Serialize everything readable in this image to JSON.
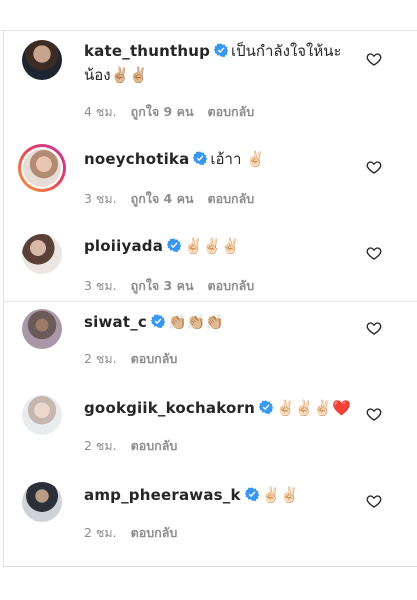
{
  "comments": [
    {
      "username": "kate_thunthup",
      "verified": true,
      "text_line1": "เป็นกำลังใจให้นะ",
      "text_line2": "น้อง✌🏼✌🏼",
      "time": "4 ชม.",
      "likes": "ถูกใจ 9 คน",
      "reply": "ตอบกลับ"
    },
    {
      "username": "noeychotika",
      "verified": true,
      "text_line1": "เอ้าา ✌🏻",
      "time": "3 ชม.",
      "likes": "ถูกใจ 4 คน",
      "reply": "ตอบกลับ"
    },
    {
      "username": "ploiiyada",
      "verified": true,
      "text_line1": "✌🏻✌🏻✌🏻",
      "time": "3 ชม.",
      "likes": "ถูกใจ 3 คน",
      "reply": "ตอบกลับ"
    },
    {
      "username": "siwat_c",
      "verified": true,
      "text_line1": "👏🏼👏🏼👏🏼",
      "time": "2 ชม.",
      "reply": "ตอบกลับ"
    },
    {
      "username": "gookgiik_kochakorn",
      "verified": true,
      "text_line1": "✌🏻✌🏻✌🏻❤️",
      "time": "2 ชม.",
      "reply": "ตอบกลับ"
    },
    {
      "username": "amp_pheerawas_k",
      "verified": true,
      "text_line1": "✌🏻✌🏻",
      "time": "2 ชม.",
      "reply": "ตอบกลับ"
    }
  ],
  "icons": {
    "verified": "verified-badge-icon",
    "like": "heart-outline-icon"
  },
  "colors": {
    "verified": "#3897f0",
    "muted": "#8e8e8e",
    "text": "#262626"
  }
}
